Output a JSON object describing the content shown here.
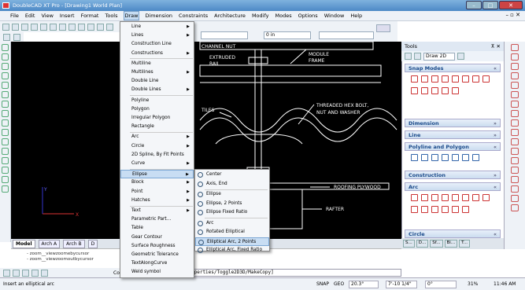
{
  "window": {
    "title": "DoubleCAD XT Pro - [Drawing1 World Plan]"
  },
  "menubar": [
    "File",
    "Edit",
    "View",
    "Insert",
    "Format",
    "Tools",
    "Draw",
    "Dimension",
    "Constraints",
    "Architecture",
    "Modify",
    "Modes",
    "Options",
    "Window",
    "Help"
  ],
  "draw_toolbar": {
    "combo1": "",
    "combo2": "0 in",
    "combo3": ""
  },
  "draw_menu": {
    "items": [
      {
        "label": "Line",
        "sub": true
      },
      {
        "label": "Lines",
        "sub": true
      },
      {
        "label": "Construction Line",
        "sub": false
      },
      {
        "label": "Constructions",
        "sub": true
      },
      {
        "label": "Multiline",
        "sub": false
      },
      {
        "label": "Multilines",
        "sub": true
      },
      {
        "label": "Double Line",
        "sub": false
      },
      {
        "label": "Double Lines",
        "sub": true
      },
      {
        "label": "Polyline",
        "sub": false
      },
      {
        "label": "Polygon",
        "sub": false
      },
      {
        "label": "Irregular Polygon",
        "sub": false
      },
      {
        "label": "Rectangle",
        "sub": false
      },
      {
        "label": "Arc",
        "sub": true
      },
      {
        "label": "Circle",
        "sub": true
      },
      {
        "label": "2D Spline, By Fit Points",
        "sub": false
      },
      {
        "label": "Curve",
        "sub": true
      },
      {
        "label": "Ellipse",
        "sub": true
      },
      {
        "label": "Block",
        "sub": true
      },
      {
        "label": "Point",
        "sub": true
      },
      {
        "label": "Hatches",
        "sub": true
      },
      {
        "label": "Text",
        "sub": true
      },
      {
        "label": "Parametric Part...",
        "sub": false
      },
      {
        "label": "Table",
        "sub": false
      },
      {
        "label": "Gear Contour",
        "sub": false
      },
      {
        "label": "Surface Roughness",
        "sub": false
      },
      {
        "label": "Geometric Tolerance",
        "sub": false
      },
      {
        "label": "TextAlongCurve",
        "sub": false
      },
      {
        "label": "Weld symbol",
        "sub": false
      }
    ]
  },
  "ellipse_submenu": {
    "items": [
      "Center",
      "Axis, End",
      "Ellipse",
      "Ellipse, 2 Points",
      "Ellipse Fixed Ratio",
      "Arc",
      "Rotated Elliptical",
      "Elliptical Arc, 2 Points",
      "Elliptical Arc, Fixed Ratio"
    ]
  },
  "drawing": {
    "labels": [
      "CHANNEL NUT",
      "EXTRUDED",
      "RAIL",
      "MODULE",
      "FRAME",
      "TILES",
      "THREADED HEX BOLT,",
      "NUT AND WASHER",
      "ROOFING PLYWOOD",
      "RAFTER"
    ],
    "ucs_x": "X",
    "ucs_y": "Y"
  },
  "tabs": [
    "Model",
    "Arch A",
    "Arch B",
    "D"
  ],
  "command_history": [
    "- zoom__viewzoomebycursor",
    "- zoom__viewzoomoutbycursor"
  ],
  "command": {
    "label": "Command:",
    "text": "operties/Toggle2D3D/MakeCopy]"
  },
  "status": {
    "message": "Insert an elliptical arc",
    "snap": "SNAP",
    "geo": "GEO",
    "angle": "20.3°",
    "coord": "7'-10 1/4\"",
    "extra": "0°",
    "zoom": "31%",
    "time": "11:46 AM"
  },
  "tools_panel": {
    "title": "Tools",
    "dropdown": "Draw 2D",
    "sections": [
      "Snap Modes",
      "Dimension",
      "Line",
      "Polyline and Polygon",
      "Construction",
      "Arc",
      "Circle"
    ]
  },
  "bottom_tabs": [
    "S...",
    "D...",
    "Sf...",
    "Bi...",
    "T..."
  ]
}
